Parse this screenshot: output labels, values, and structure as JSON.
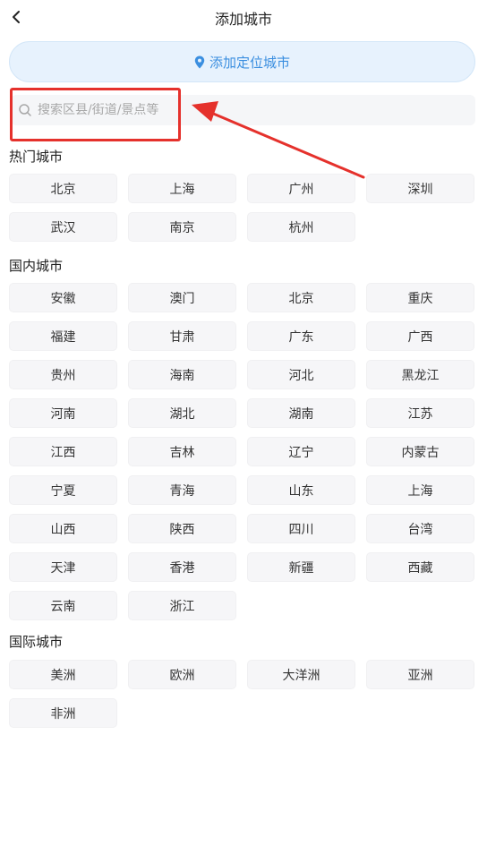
{
  "header": {
    "title": "添加城市"
  },
  "locate_button": {
    "label": "添加定位城市"
  },
  "search": {
    "placeholder": "搜索区县/街道/景点等"
  },
  "sections": {
    "hot": {
      "title": "热门城市",
      "items": [
        "北京",
        "上海",
        "广州",
        "深圳",
        "武汉",
        "南京",
        "杭州"
      ]
    },
    "domestic": {
      "title": "国内城市",
      "items": [
        "安徽",
        "澳门",
        "北京",
        "重庆",
        "福建",
        "甘肃",
        "广东",
        "广西",
        "贵州",
        "海南",
        "河北",
        "黑龙江",
        "河南",
        "湖北",
        "湖南",
        "江苏",
        "江西",
        "吉林",
        "辽宁",
        "内蒙古",
        "宁夏",
        "青海",
        "山东",
        "上海",
        "山西",
        "陕西",
        "四川",
        "台湾",
        "天津",
        "香港",
        "新疆",
        "西藏",
        "云南",
        "浙江"
      ]
    },
    "international": {
      "title": "国际城市",
      "items": [
        "美洲",
        "欧洲",
        "大洋洲",
        "亚洲",
        "非洲"
      ]
    }
  },
  "colors": {
    "accent": "#3b8fe0",
    "annotation": "#e5312c"
  },
  "icons": {
    "back": "chevron-left-icon",
    "location": "location-pin-icon",
    "search": "search-icon"
  }
}
